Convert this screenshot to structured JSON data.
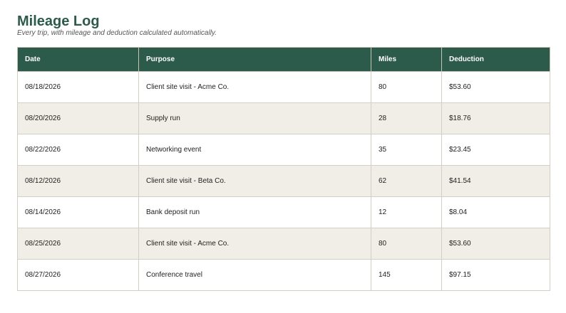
{
  "header": {
    "title": "Mileage Log",
    "subtitle": "Every trip, with mileage and deduction calculated automatically."
  },
  "table": {
    "columns": [
      "Date",
      "Purpose",
      "Miles",
      "Deduction"
    ],
    "rows": [
      [
        "08/18/2026",
        "Client site visit - Acme Co.",
        "80",
        "$53.60"
      ],
      [
        "08/20/2026",
        "Supply run",
        "28",
        "$18.76"
      ],
      [
        "08/22/2026",
        "Networking event",
        "35",
        "$23.45"
      ],
      [
        "08/12/2026",
        "Client site visit - Beta Co.",
        "62",
        "$41.54"
      ],
      [
        "08/14/2026",
        "Bank deposit run",
        "12",
        "$8.04"
      ],
      [
        "08/25/2026",
        "Client site visit - Acme Co.",
        "80",
        "$53.60"
      ],
      [
        "08/27/2026",
        "Conference travel",
        "145",
        "$97.15"
      ]
    ]
  },
  "colors": {
    "accent": "#2c5a4b",
    "row_alt": "#f1eee7",
    "border": "#d4cfc4"
  }
}
